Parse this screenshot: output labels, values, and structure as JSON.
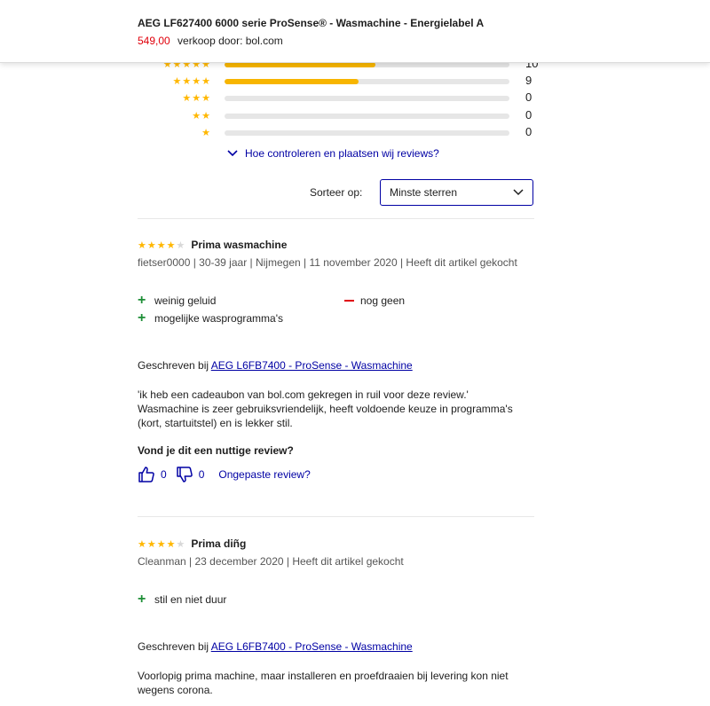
{
  "header": {
    "title": "AEG LF627400 6000 serie ProSense® - Wasmachine - Energielabel A",
    "price": "549,00",
    "seller": "verkoop door: bol.com"
  },
  "distribution": [
    {
      "stars": "★★★★★",
      "fill": 0.53,
      "count": "10"
    },
    {
      "stars": "★★★★",
      "fill": 0.47,
      "count": "9"
    },
    {
      "stars": "★★★",
      "fill": 0,
      "count": "0"
    },
    {
      "stars": "★★",
      "fill": 0,
      "count": "0"
    },
    {
      "stars": "★",
      "fill": 0,
      "count": "0"
    }
  ],
  "how_link": "Hoe controleren en plaatsen wij reviews?",
  "sort": {
    "label": "Sorteer op:",
    "value": "Minste sterren"
  },
  "reviews": [
    {
      "rating": 4,
      "title": "Prima wasmachine",
      "meta": "fietser0000 | 30-39 jaar | Nijmegen | 11 november 2020 | Heeft dit artikel gekocht",
      "pros": [
        "weinig geluid",
        "mogelijke wasprogramma's"
      ],
      "cons": [
        "nog geen"
      ],
      "written_prefix": "Geschreven bij",
      "product_link": "AEG L6FB7400 - ProSense - Wasmachine",
      "text_lines": [
        "'ik heb een cadeaubon van bol.com gekregen in ruil voor deze review.'",
        "Wasmachine is zeer gebruiksvriendelijk, heeft voldoende keuze in programma's",
        "(kort, startuitstel) en is lekker stil."
      ],
      "helpful_q": "Vond je dit een nuttige review?",
      "up": "0",
      "down": "0",
      "report": "Ongepaste review?"
    },
    {
      "rating": 4,
      "title": "Prima diñg",
      "meta": "Cleanman | 23 december 2020 | Heeft dit artikel gekocht",
      "pros": [
        "stil en niet duur"
      ],
      "cons": [],
      "written_prefix": "Geschreven bij",
      "product_link": "AEG L6FB7400 - ProSense - Wasmachine",
      "text_lines": [
        "Voorlopig prima machine, maar installeren en proefdraaien bij levering kon niet",
        "wegens corona."
      ]
    }
  ],
  "colors": {
    "accent": "#0000a4",
    "star": "#ffb700",
    "price": "#e0000b",
    "pro": "#1d8e36"
  }
}
